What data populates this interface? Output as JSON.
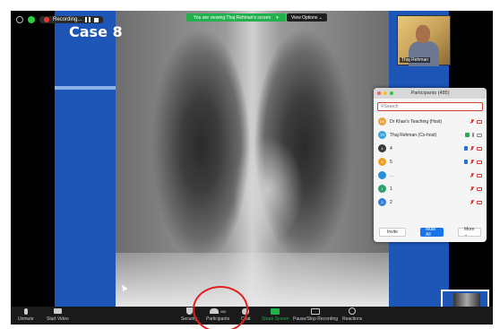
{
  "status_bar": {
    "recording_label": "Recording..."
  },
  "share_banner": {
    "text": "You are viewing Thaj Rehman's screen",
    "view_options_label": "View Options ⌄"
  },
  "shared_screen": {
    "case_title": "Case 8"
  },
  "video_tile": {
    "name": "Thaj Rehman"
  },
  "participants_panel": {
    "title": "Participants (485)",
    "search_placeholder": "Search",
    "rows": [
      {
        "initials": "DK",
        "name": "Dr Khan's Teaching (Host)",
        "color": "#e8a33c"
      },
      {
        "initials": "TR",
        "name": "Thaj Rehman (Co-host)",
        "color": "#3aa0d8"
      },
      {
        "initials": "4",
        "name": "4",
        "color": "#3a3a3a"
      },
      {
        "initials": "5",
        "name": "5",
        "color": "#f0a020"
      },
      {
        "initials": "",
        "name": "...",
        "color": "#2b8fd6"
      },
      {
        "initials": "1",
        "name": "1",
        "color": "#2aa06a"
      },
      {
        "initials": "2",
        "name": "2",
        "color": "#3a7fd6"
      }
    ],
    "invite_label": "Invite",
    "mute_all_label": "Mute All",
    "more_label": "More ⌄"
  },
  "toolbar": {
    "unmute_label": "Unmute",
    "start_video_label": "Start Video",
    "security_label": "Security",
    "participants_label": "Participants",
    "participants_count": "485",
    "chat_label": "Chat",
    "share_screen_label": "Share Screen",
    "pause_record_label": "Pause/Stop Recording",
    "reactions_label": "Reactions"
  },
  "colors": {
    "accent_green": "#22b14c",
    "highlight_red": "#e02020",
    "slide_blue": "#1e56b8"
  }
}
